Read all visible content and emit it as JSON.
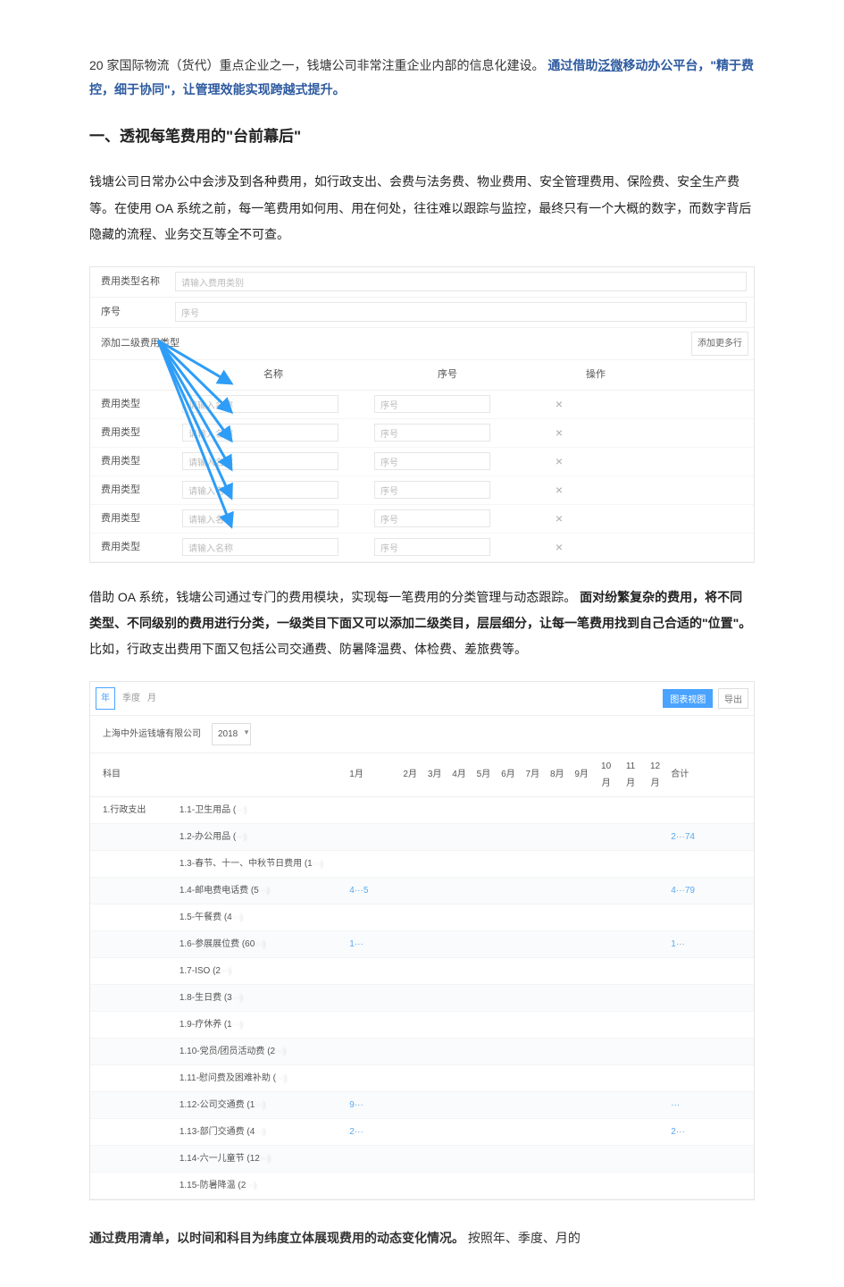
{
  "intro": {
    "prefix": "20 家国际物流（货代）重点企业之一，钱塘公司非常注重企业内部的信息化建设。",
    "bold_part1": "通过借助",
    "link_text": "泛微",
    "bold_part2": "移动办公平台，\"精于费控，细于协同\"，让管理效能实现跨越式提升。"
  },
  "section1_title": "一、透视每笔费用的\"台前幕后\"",
  "para1": "钱塘公司日常办公中会涉及到各种费用，如行政支出、会费与法务费、物业费用、安全管理费用、保险费、安全生产费等。在使用 OA 系统之前，每一笔费用如何用、用在何处，往往难以跟踪与监控，最终只有一个大概的数字，而数字背后隐藏的流程、业务交互等全不可查。",
  "fig1": {
    "field_type_name_label": "费用类型名称",
    "field_type_name_placeholder": "请输入费用类别",
    "field_seq_label": "序号",
    "field_seq_placeholder": "序号",
    "add_secondary_label": "添加二级费用类型",
    "add_more": "添加更多行",
    "sub_header": {
      "name": "名称",
      "seq": "序号",
      "op": "操作"
    },
    "rows": [
      {
        "label": "费用类型",
        "name_ph": "请输入名称",
        "seq_ph": "序号"
      },
      {
        "label": "费用类型",
        "name_ph": "请输入名称",
        "seq_ph": "序号"
      },
      {
        "label": "费用类型",
        "name_ph": "请输入名称",
        "seq_ph": "序号"
      },
      {
        "label": "费用类型",
        "name_ph": "请输入名称",
        "seq_ph": "序号"
      },
      {
        "label": "费用类型",
        "name_ph": "请输入名称",
        "seq_ph": "序号"
      },
      {
        "label": "费用类型",
        "name_ph": "请输入名称",
        "seq_ph": "序号"
      }
    ]
  },
  "para2_prefix": "借助 OA 系统，钱塘公司通过专门的费用模块，实现每一笔费用的分类管理与动态跟踪。",
  "para2_bold": "面对纷繁复杂的费用，将不同类型、不同级别的费用进行分类，一级类目下面又可以添加二级类目，层层细分，让每一笔费用找到自己合适的\"位置\"。",
  "para2_suffix": "比如，行政支出费用下面又包括公司交通费、防暑降温费、体检费、差旅费等。",
  "fig2": {
    "tab_year": "年",
    "tab_quarter": "季度",
    "tab_month": "月",
    "btn_chart": "图表视图",
    "btn_export": "导出",
    "company": "上海中外运钱塘有限公司",
    "year_selected": "2018",
    "header": {
      "subject": "科目",
      "jan": "1月",
      "months": [
        "2月",
        "3月",
        "4月",
        "5月",
        "6月",
        "7月",
        "8月",
        "9月",
        "10月",
        "11月",
        "12月"
      ],
      "total": "合计"
    },
    "subject1": "1.行政支出",
    "items": [
      {
        "name": "1.1-卫生用品 (",
        "jan": "",
        "total": ""
      },
      {
        "name": "1.2-办公用品 (",
        "jan": "",
        "total": "2···74"
      },
      {
        "name": "1.3-春节、十一、中秋节日费用 (1",
        "jan": "",
        "total": ""
      },
      {
        "name": "1.4-邮电费电话费 (5",
        "jan": "4···5",
        "total": "4···79"
      },
      {
        "name": "1.5-午餐费 (4",
        "jan": "",
        "total": ""
      },
      {
        "name": "1.6-参展展位费 (60",
        "jan": "1···",
        "total": "1···"
      },
      {
        "name": "1.7-ISO (2",
        "jan": "",
        "total": ""
      },
      {
        "name": "1.8-生日费 (3",
        "jan": "",
        "total": ""
      },
      {
        "name": "1.9-疗休养 (1",
        "jan": "",
        "total": ""
      },
      {
        "name": "1.10-党员/团员活动费 (2",
        "jan": "",
        "total": ""
      },
      {
        "name": "1.11-慰问费及困难补助 (",
        "jan": "",
        "total": ""
      },
      {
        "name": "1.12-公司交通费 (1",
        "jan": "9···",
        "total": "···"
      },
      {
        "name": "1.13-部门交通费 (4",
        "jan": "2···",
        "total": "2···"
      },
      {
        "name": "1.14-六一儿童节 (12",
        "jan": "",
        "total": ""
      },
      {
        "name": "1.15-防暑降温 (2",
        "jan": "",
        "total": ""
      }
    ]
  },
  "closing_bold": "通过费用清单，以时间和科目为纬度立体展现费用的动态变化情况。",
  "closing_rest": "按照年、季度、月的"
}
